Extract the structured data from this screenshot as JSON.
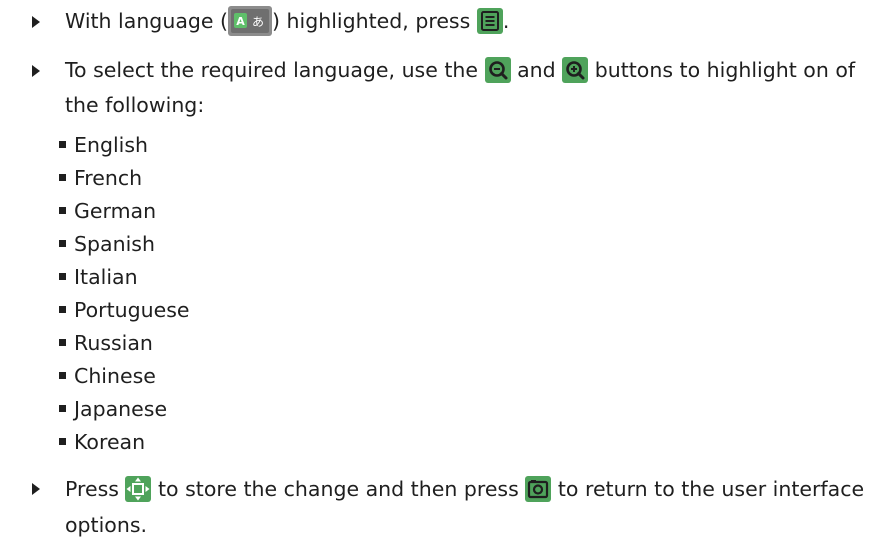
{
  "step1": {
    "before": "With language (",
    "middle": ") highlighted, press",
    "after": ".",
    "language_icon": "language-icon",
    "menu_icon": "menu-icon"
  },
  "step2": {
    "before": "To select the required language, use the",
    "between": "and",
    "after": "buttons to highlight on of the following:",
    "zoom_out_icon": "zoom-out-icon",
    "zoom_in_icon": "zoom-in-icon"
  },
  "languages": [
    "English",
    "French",
    "German",
    "Spanish",
    "Italian",
    "Portuguese",
    "Russian",
    "Chinese",
    "Japanese",
    "Korean"
  ],
  "step3": {
    "before": "Press",
    "middle": "to store the change and then press",
    "after": "to return to the user interface options.",
    "navigate_icon": "navigate-icon",
    "camera_icon": "camera-icon"
  },
  "colors": {
    "icon_green": "#4fa35b",
    "icon_gray": "#8c8c8c",
    "text": "#1f1f1f"
  }
}
